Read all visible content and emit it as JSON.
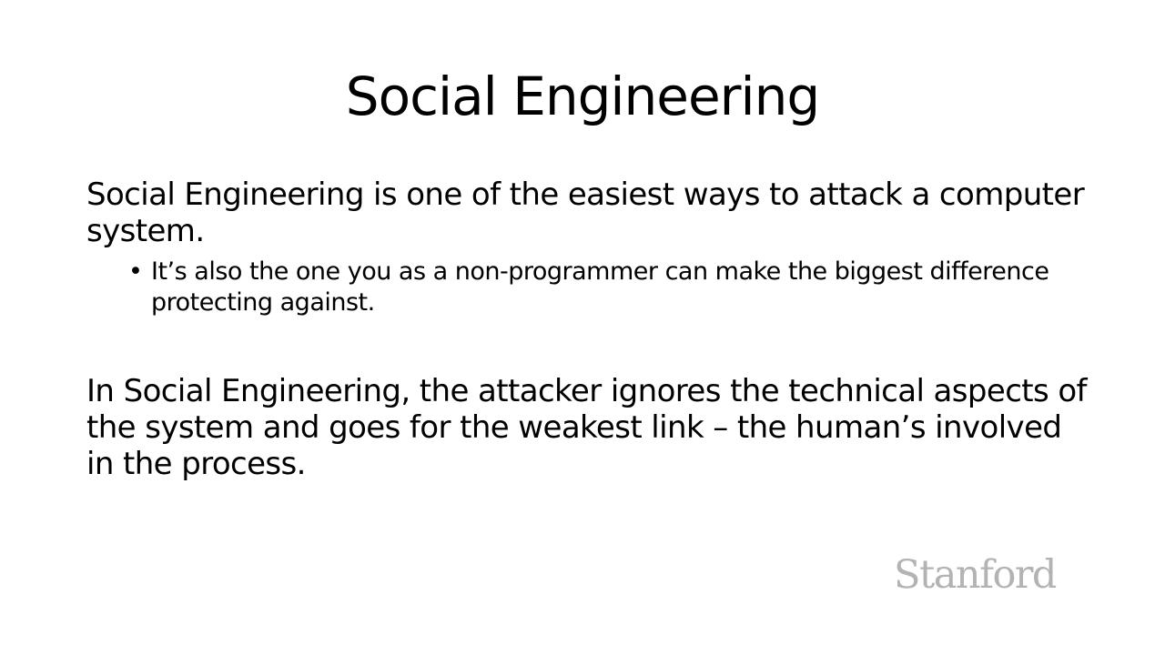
{
  "slide": {
    "title": "Social Engineering",
    "paragraph_1": "Social Engineering is one of the easiest ways to attack a computer system.",
    "bullets": [
      {
        "marker": "•",
        "text": "It’s also the one you as a non-programmer can make the biggest difference protecting against."
      }
    ],
    "paragraph_2": "In Social Engineering, the attacker ignores the technical aspects of the system and goes for the weakest link – the human’s involved in the process.",
    "logo_text": "Stanford"
  }
}
